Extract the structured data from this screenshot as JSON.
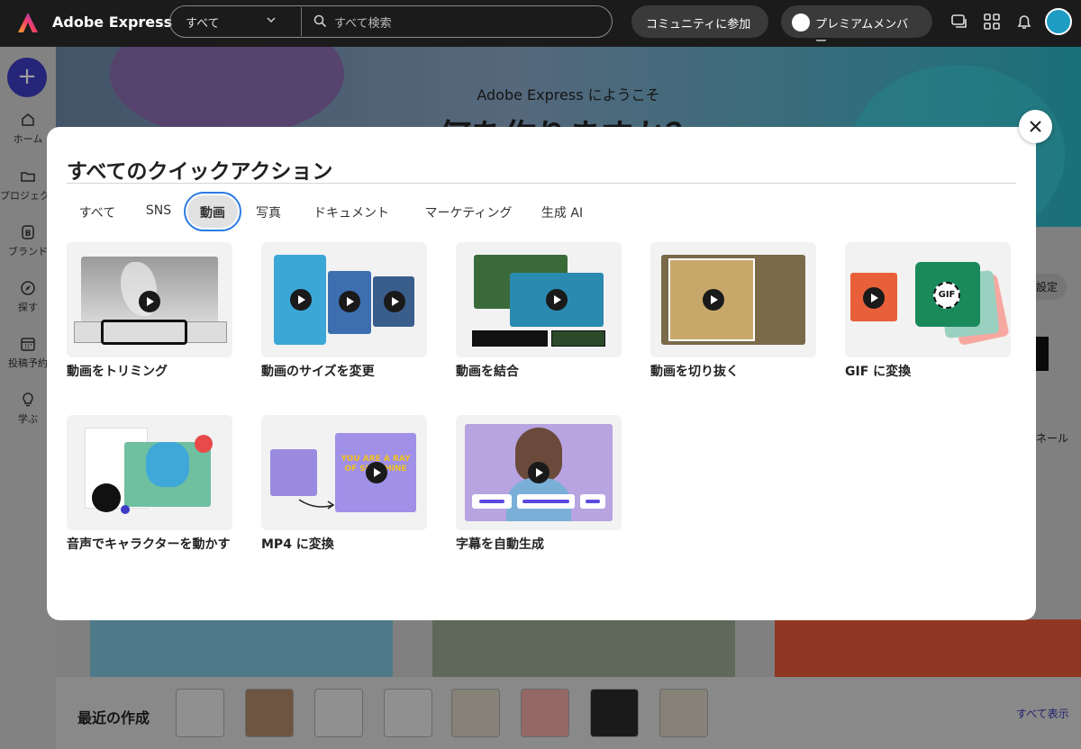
{
  "app": {
    "brand": "Adobe Express"
  },
  "topbar": {
    "scope_label": "すべて",
    "search_placeholder": "すべて検索",
    "community_label": "コミュニティに参加",
    "premium_label": "プレミアムメンバー"
  },
  "rail": {
    "create_label": "+",
    "items": [
      {
        "label": "ホーム",
        "icon": "home-icon"
      },
      {
        "label": "プロジェクト",
        "icon": "folder-icon"
      },
      {
        "label": "ブランド",
        "icon": "brand-icon"
      },
      {
        "label": "探す",
        "icon": "compass-icon"
      },
      {
        "label": "投稿予約",
        "icon": "calendar-icon"
      },
      {
        "label": "学ぶ",
        "icon": "lightbulb-icon"
      }
    ]
  },
  "background": {
    "hero_subtitle": "Adobe Express にようこそ",
    "hero_title": "何を作りますか？",
    "side_button": "設定",
    "side_label": "ネール",
    "recent_title": "最近の作成",
    "see_all": "すべて表示"
  },
  "modal": {
    "title": "すべてのクイックアクション",
    "tabs": [
      {
        "label": "すべて"
      },
      {
        "label": "SNS"
      },
      {
        "label": "動画",
        "active": true
      },
      {
        "label": "写真"
      },
      {
        "label": "ドキュメント"
      },
      {
        "label": "マーケティング"
      },
      {
        "label": "生成 AI"
      }
    ],
    "actions": [
      {
        "label": "動画をトリミング"
      },
      {
        "label": "動画のサイズを変更"
      },
      {
        "label": "動画を結合"
      },
      {
        "label": "動画を切り抜く"
      },
      {
        "label": "GIF に変換",
        "badge": "GIF"
      },
      {
        "label": "音声でキャラクターを動かす"
      },
      {
        "label": "MP4 に変換",
        "thumb_text": "YOU ARE A RAY OF SUNSHINE"
      },
      {
        "label": "字幕を自動生成"
      }
    ]
  },
  "colors": {
    "topbar": "#1b1b1b",
    "create_button": "#3d3cc4",
    "active_tab_outline": "#2a7ae2",
    "link": "#3535b0"
  }
}
